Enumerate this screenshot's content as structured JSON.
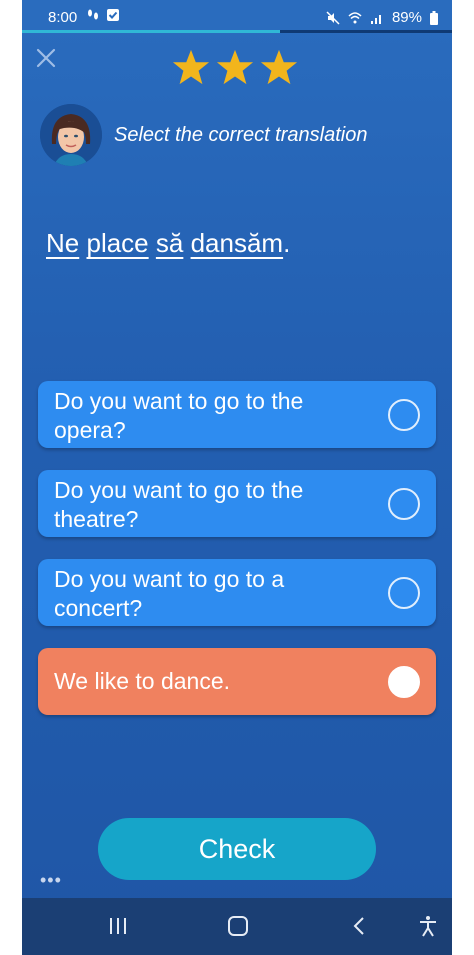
{
  "status_bar": {
    "time": "8:00",
    "battery": "89%"
  },
  "progress": {
    "value": 0.6
  },
  "lesson": {
    "stars": 3,
    "instruction": "Select the correct translation",
    "sentence_words": [
      "Ne",
      "place",
      "să",
      "dansăm"
    ],
    "sentence_end": "."
  },
  "options": [
    {
      "line1": "Do you want to go to the",
      "line2": "opera?",
      "selected": false
    },
    {
      "line1": "Do you want to go to the",
      "line2": "theatre?",
      "selected": false
    },
    {
      "line1": "Do you want to go to a",
      "line2": "concert?",
      "selected": false
    },
    {
      "line1": "We like to dance.",
      "line2": "",
      "selected": true
    }
  ],
  "check_button": {
    "label": "Check"
  },
  "colors": {
    "background": "#235fb1",
    "option": "#2e8cf0",
    "selected_option": "#f0815f",
    "check_button": "#16a5c9",
    "star": "#f2b51c"
  },
  "icons": [
    "close-icon",
    "star-icon",
    "avatar",
    "radio-icon",
    "more-icon",
    "recent-apps-icon",
    "home-icon",
    "back-icon",
    "accessibility-icon"
  ]
}
